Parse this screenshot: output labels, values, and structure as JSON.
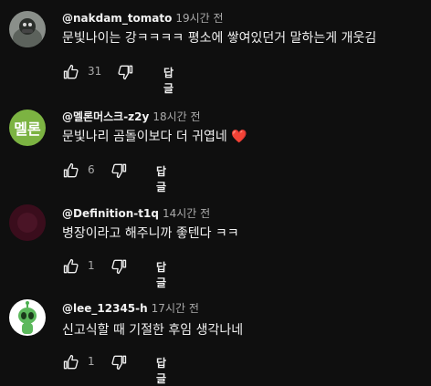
{
  "comments": [
    {
      "author": "@nakdam_tomato",
      "time": "19시간 전",
      "text": "문빛나이는 강ㅋㅋㅋㅋ 평소에 쌓여있던거 말하는게  개웃김",
      "likes": "31",
      "reply_label": "답글",
      "avatar_icon": "photo-avatar"
    },
    {
      "author": "@멜론머스크-z2y",
      "time": "18시간 전",
      "text": "문빛나리 곰돌이보다 더 귀엽네",
      "emoji": "❤️",
      "likes": "6",
      "reply_label": "답글",
      "avatar_text": "멜론",
      "avatar_color": "#7cb342"
    },
    {
      "author": "@Definition-t1q",
      "time": "14시간 전",
      "text": "병장이라고 해주니까 좋텐다 ㅋㅋ",
      "likes": "1",
      "reply_label": "답글",
      "avatar_color": "#3a0d1c"
    },
    {
      "author": "@lee_12345-h",
      "time": "17시간 전",
      "text": "신고식할 때 기절한 후임 생각나네",
      "likes": "1",
      "reply_label": "답글",
      "avatar_icon": "alien-avatar"
    }
  ]
}
